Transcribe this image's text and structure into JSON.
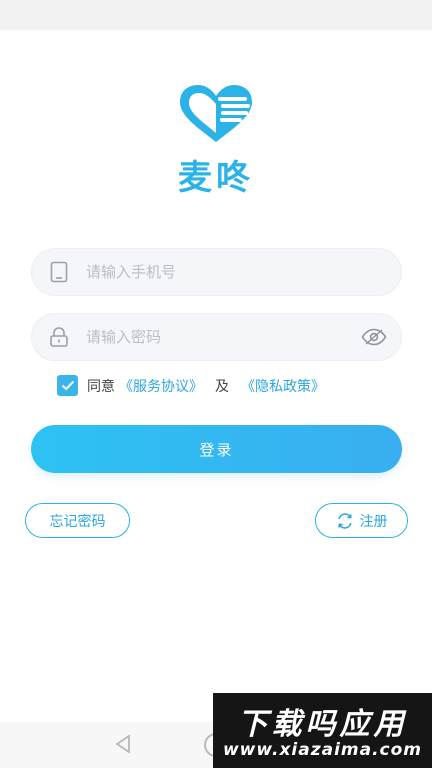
{
  "app": {
    "name": "麦咚",
    "brand_color": "#2bb3e8"
  },
  "login": {
    "phone_placeholder": "请输入手机号",
    "phone_icon": "phone-icon",
    "password_placeholder": "请输入密码",
    "password_icon": "lock-icon",
    "visibility_icon": "eye-icon",
    "agree_checked": true,
    "agree_prefix": "同意",
    "service_agreement": "《服务协议》",
    "and_text": "及",
    "privacy_policy": "《隐私政策》",
    "login_button": "登录",
    "forgot_password": "忘记密码",
    "register": "注册",
    "register_icon": "refresh-icon"
  },
  "watermark": {
    "title": "下载吗应用",
    "url": "www.xiazaima.com"
  }
}
